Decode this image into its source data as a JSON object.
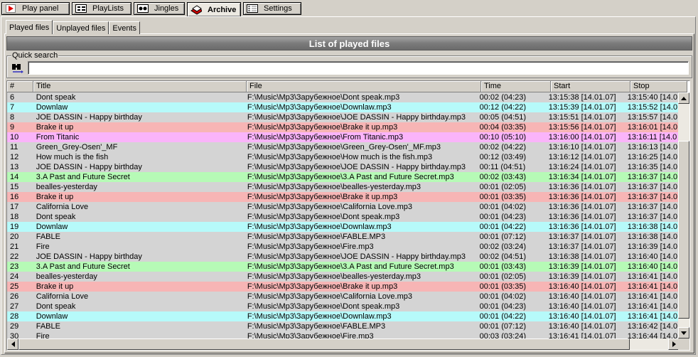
{
  "tabs": [
    {
      "label": "Play panel",
      "icon": "play-icon"
    },
    {
      "label": "PlayLists",
      "icon": "playlist-icon"
    },
    {
      "label": "Jingles",
      "icon": "jingles-icon"
    },
    {
      "label": "Archive",
      "icon": "archive-icon",
      "active": true
    },
    {
      "label": "Settings",
      "icon": "settings-icon"
    }
  ],
  "subtabs": [
    "Played files",
    "Unplayed files",
    "Events"
  ],
  "header": {
    "title": "List of played files"
  },
  "quick_search": {
    "label": "Quick search",
    "value": ""
  },
  "columns": [
    "#",
    "Title",
    "File",
    "Time",
    "Start",
    "Stop"
  ],
  "colors": {
    "gray": "#d4d4d4",
    "cyan": "#b6fafa",
    "red": "#f7b5b5",
    "pink": "#fab4fa",
    "green": "#b6fab6"
  },
  "rows": [
    {
      "n": "6",
      "title": "Dont speak",
      "file": "F:\\Music\\Mp3\\Зарубежное\\Dont speak.mp3",
      "time": "00:02 (04:23)",
      "start": "13:15:38 [14.01.07]",
      "stop": "13:15:40 [14.0",
      "color": "gray"
    },
    {
      "n": "7",
      "title": "Downlaw",
      "file": "F:\\Music\\Mp3\\Зарубежное\\Downlaw.mp3",
      "time": "00:12 (04:22)",
      "start": "13:15:39 [14.01.07]",
      "stop": "13:15:52 [14.0",
      "color": "cyan"
    },
    {
      "n": "8",
      "title": "JOE DASSIN - Happy birthday",
      "file": "F:\\Music\\Mp3\\Зарубежное\\JOE DASSIN - Happy birthday.mp3",
      "time": "00:05 (04:51)",
      "start": "13:15:51 [14.01.07]",
      "stop": "13:15:57 [14.0",
      "color": "gray"
    },
    {
      "n": "9",
      "title": "Brake it up",
      "file": "F:\\Music\\Mp3\\Зарубежное\\Brake it up.mp3",
      "time": "00:04 (03:35)",
      "start": "13:15:56 [14.01.07]",
      "stop": "13:16:01 [14.0",
      "color": "red"
    },
    {
      "n": "10",
      "title": "From Titanic",
      "file": "F:\\Music\\Mp3\\Зарубежное\\From Titanic.mp3",
      "time": "00:10 (05:10)",
      "start": "13:16:00 [14.01.07]",
      "stop": "13:16:11 [14.0",
      "color": "pink"
    },
    {
      "n": "11",
      "title": "Green_Grey-Osen'_MF",
      "file": "F:\\Music\\Mp3\\Зарубежное\\Green_Grey-Osen'_MF.mp3",
      "time": "00:02 (04:22)",
      "start": "13:16:10 [14.01.07]",
      "stop": "13:16:13 [14.0",
      "color": "gray"
    },
    {
      "n": "12",
      "title": "How much is the fish",
      "file": "F:\\Music\\Mp3\\Зарубежное\\How much is the fish.mp3",
      "time": "00:12 (03:49)",
      "start": "13:16:12 [14.01.07]",
      "stop": "13:16:25 [14.0",
      "color": "gray"
    },
    {
      "n": "13",
      "title": "JOE DASSIN - Happy birthday",
      "file": "F:\\Music\\Mp3\\Зарубежное\\JOE DASSIN - Happy birthday.mp3",
      "time": "00:11 (04:51)",
      "start": "13:16:24 [14.01.07]",
      "stop": "13:16:35 [14.0",
      "color": "gray"
    },
    {
      "n": "14",
      "title": "3.A Past and Future Secret",
      "file": "F:\\Music\\Mp3\\Зарубежное\\3.A Past and Future Secret.mp3",
      "time": "00:02 (03:43)",
      "start": "13:16:34 [14.01.07]",
      "stop": "13:16:37 [14.0",
      "color": "green"
    },
    {
      "n": "15",
      "title": "bealles-yesterday",
      "file": "F:\\Music\\Mp3\\Зарубежное\\bealles-yesterday.mp3",
      "time": "00:01 (02:05)",
      "start": "13:16:36 [14.01.07]",
      "stop": "13:16:37 [14.0",
      "color": "gray"
    },
    {
      "n": "16",
      "title": "Brake it up",
      "file": "F:\\Music\\Mp3\\Зарубежное\\Brake it up.mp3",
      "time": "00:01 (03:35)",
      "start": "13:16:36 [14.01.07]",
      "stop": "13:16:37 [14.0",
      "color": "red"
    },
    {
      "n": "17",
      "title": "California Love",
      "file": "F:\\Music\\Mp3\\Зарубежное\\California Love.mp3",
      "time": "00:01 (04:02)",
      "start": "13:16:36 [14.01.07]",
      "stop": "13:16:37 [14.0",
      "color": "gray"
    },
    {
      "n": "18",
      "title": "Dont speak",
      "file": "F:\\Music\\Mp3\\Зарубежное\\Dont speak.mp3",
      "time": "00:01 (04:23)",
      "start": "13:16:36 [14.01.07]",
      "stop": "13:16:37 [14.0",
      "color": "gray"
    },
    {
      "n": "19",
      "title": "Downlaw",
      "file": "F:\\Music\\Mp3\\Зарубежное\\Downlaw.mp3",
      "time": "00:01 (04:22)",
      "start": "13:16:36 [14.01.07]",
      "stop": "13:16:38 [14.0",
      "color": "cyan"
    },
    {
      "n": "20",
      "title": "FABLE",
      "file": "F:\\Music\\Mp3\\Зарубежное\\FABLE.MP3",
      "time": "00:01 (07:12)",
      "start": "13:16:37 [14.01.07]",
      "stop": "13:16:38 [14.0",
      "color": "gray"
    },
    {
      "n": "21",
      "title": "Fire",
      "file": "F:\\Music\\Mp3\\Зарубежное\\Fire.mp3",
      "time": "00:02 (03:24)",
      "start": "13:16:37 [14.01.07]",
      "stop": "13:16:39 [14.0",
      "color": "gray"
    },
    {
      "n": "22",
      "title": "JOE DASSIN - Happy birthday",
      "file": "F:\\Music\\Mp3\\Зарубежное\\JOE DASSIN - Happy birthday.mp3",
      "time": "00:02 (04:51)",
      "start": "13:16:38 [14.01.07]",
      "stop": "13:16:40 [14.0",
      "color": "gray"
    },
    {
      "n": "23",
      "title": "3.A Past and Future Secret",
      "file": "F:\\Music\\Mp3\\Зарубежное\\3.A Past and Future Secret.mp3",
      "time": "00:01 (03:43)",
      "start": "13:16:39 [14.01.07]",
      "stop": "13:16:40 [14.0",
      "color": "green"
    },
    {
      "n": "24",
      "title": "bealles-yesterday",
      "file": "F:\\Music\\Mp3\\Зарубежное\\bealles-yesterday.mp3",
      "time": "00:01 (02:05)",
      "start": "13:16:39 [14.01.07]",
      "stop": "13:16:41 [14.0",
      "color": "gray"
    },
    {
      "n": "25",
      "title": "Brake it up",
      "file": "F:\\Music\\Mp3\\Зарубежное\\Brake it up.mp3",
      "time": "00:01 (03:35)",
      "start": "13:16:40 [14.01.07]",
      "stop": "13:16:41 [14.0",
      "color": "red"
    },
    {
      "n": "26",
      "title": "California Love",
      "file": "F:\\Music\\Mp3\\Зарубежное\\California Love.mp3",
      "time": "00:01 (04:02)",
      "start": "13:16:40 [14.01.07]",
      "stop": "13:16:41 [14.0",
      "color": "gray"
    },
    {
      "n": "27",
      "title": "Dont speak",
      "file": "F:\\Music\\Mp3\\Зарубежное\\Dont speak.mp3",
      "time": "00:01 (04:23)",
      "start": "13:16:40 [14.01.07]",
      "stop": "13:16:41 [14.0",
      "color": "gray"
    },
    {
      "n": "28",
      "title": "Downlaw",
      "file": "F:\\Music\\Mp3\\Зарубежное\\Downlaw.mp3",
      "time": "00:01 (04:22)",
      "start": "13:16:40 [14.01.07]",
      "stop": "13:16:41 [14.0",
      "color": "cyan"
    },
    {
      "n": "29",
      "title": "FABLE",
      "file": "F:\\Music\\Mp3\\Зарубежное\\FABLE.MP3",
      "time": "00:01 (07:12)",
      "start": "13:16:40 [14.01.07]",
      "stop": "13:16:42 [14.0",
      "color": "gray"
    },
    {
      "n": "30",
      "title": "Fire",
      "file": "F:\\Music\\Mp3\\Зарубежное\\Fire.mp3",
      "time": "00:03 (03:24)",
      "start": "13:16:41 [14.01.07]",
      "stop": "13:16:44 [14.0",
      "color": "gray"
    }
  ]
}
